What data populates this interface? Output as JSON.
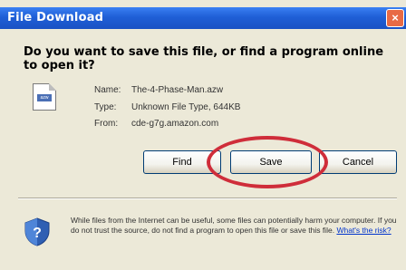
{
  "window": {
    "title": "File Download",
    "close_glyph": "×"
  },
  "question": "Do you want to save this file, or find a program online to open it?",
  "file": {
    "icon": "file-icon",
    "icon_badge": "azw",
    "name_label": "Name:",
    "name_value": "The-4-Phase-Man.azw",
    "type_label": "Type:",
    "type_value": "Unknown File Type, 644KB",
    "from_label": "From:",
    "from_value": "cde-g7g.amazon.com"
  },
  "buttons": {
    "find": "Find",
    "save": "Save",
    "cancel": "Cancel"
  },
  "warning": {
    "icon": "shield-question-icon",
    "text": "While files from the Internet can be useful, some files can potentially harm your computer. If you do not trust the source, do not find a program to open this file or save this file.",
    "link": "What's the risk?"
  },
  "colors": {
    "title_bar": "#1f5fd6",
    "dialog_bg": "#ece9d8",
    "highlight_circle": "#cf2d3a",
    "link": "#0033cc"
  }
}
